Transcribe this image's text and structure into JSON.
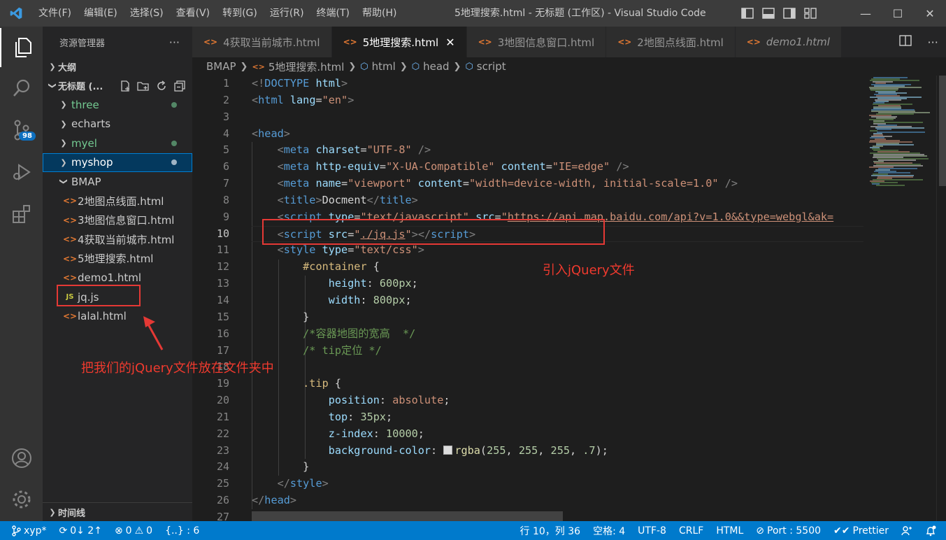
{
  "window": {
    "title": "5地理搜索.html - 无标题 (工作区) - Visual Studio Code",
    "menu": [
      "文件(F)",
      "编辑(E)",
      "选择(S)",
      "查看(V)",
      "转到(G)",
      "运行(R)",
      "终端(T)",
      "帮助(H)"
    ]
  },
  "activity": {
    "scm_badge": "98"
  },
  "sidebar": {
    "header": "资源管理器",
    "more": "···",
    "outline": "大纲",
    "workspace": "无标题 (...",
    "timeline": "时间线",
    "folders": [
      {
        "label": "three",
        "modified": true
      },
      {
        "label": "echarts",
        "modified": false
      },
      {
        "label": "myel",
        "modified": true
      },
      {
        "label": "myshop",
        "modified": true
      },
      {
        "label": "BMAP",
        "modified": false
      }
    ],
    "files": [
      {
        "label": "2地图点线面.html",
        "type": "html"
      },
      {
        "label": "3地图信息窗口.html",
        "type": "html"
      },
      {
        "label": "4获取当前城市.html",
        "type": "html"
      },
      {
        "label": "5地理搜索.html",
        "type": "html"
      },
      {
        "label": "demo1.html",
        "type": "html"
      },
      {
        "label": "jq.js",
        "type": "js"
      },
      {
        "label": "lalal.html",
        "type": "html"
      }
    ],
    "js_icon": "JS"
  },
  "tabs": [
    {
      "label": "4获取当前城市.html",
      "active": false
    },
    {
      "label": "5地理搜索.html",
      "active": true
    },
    {
      "label": "3地图信息窗口.html",
      "active": false
    },
    {
      "label": "2地图点线面.html",
      "active": false
    },
    {
      "label": "demo1.html",
      "active": false
    }
  ],
  "breadcrumb": [
    "BMAP",
    "5地理搜索.html",
    "html",
    "head",
    "script"
  ],
  "editor": {
    "line_numbers": [
      "1",
      "2",
      "3",
      "4",
      "5",
      "6",
      "7",
      "8",
      "9",
      "10",
      "11",
      "12",
      "13",
      "14",
      "15",
      "16",
      "17",
      "18",
      "19",
      "20",
      "21",
      "22",
      "23",
      "24",
      "25",
      "26",
      "27"
    ],
    "current_line": "10"
  },
  "annotations": {
    "script_note": "引入jQuery文件",
    "folder_note": "把我们的jQuery文件放在文件夹中"
  },
  "statusbar": {
    "branch": "xyp*",
    "sync": "0↓ 2↑",
    "errors": "0",
    "warnings": "0",
    "braces": "{..} : 6",
    "position": "行 10，列 36",
    "spaces": "空格: 4",
    "encoding": "UTF-8",
    "eol": "CRLF",
    "language": "HTML",
    "port": "Port : 5500",
    "prettier": "Prettier"
  },
  "colors": {
    "accent": "#007acc",
    "annotation": "#e53935",
    "modified_dot": "#73c991"
  }
}
